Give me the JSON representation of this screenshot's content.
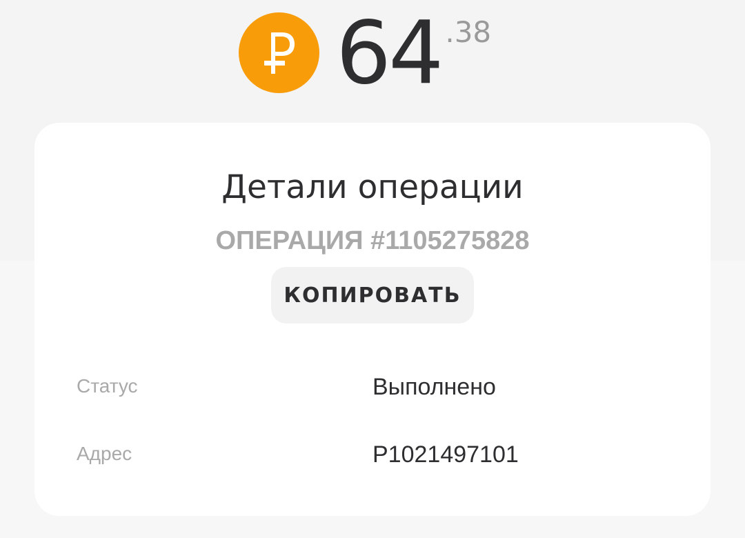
{
  "balance": {
    "integer": "64",
    "fraction": ".38",
    "currency_icon": "ruble-coin-icon",
    "coin_color": "#f89c0a"
  },
  "details": {
    "title": "Детали операции",
    "operation_number": "ОПЕРАЦИЯ #1105275828",
    "copy_label": "КОПИРОВАТЬ",
    "rows": [
      {
        "label": "Статус",
        "value": "Выполнено"
      },
      {
        "label": "Адрес",
        "value": "P1021497101"
      }
    ]
  }
}
